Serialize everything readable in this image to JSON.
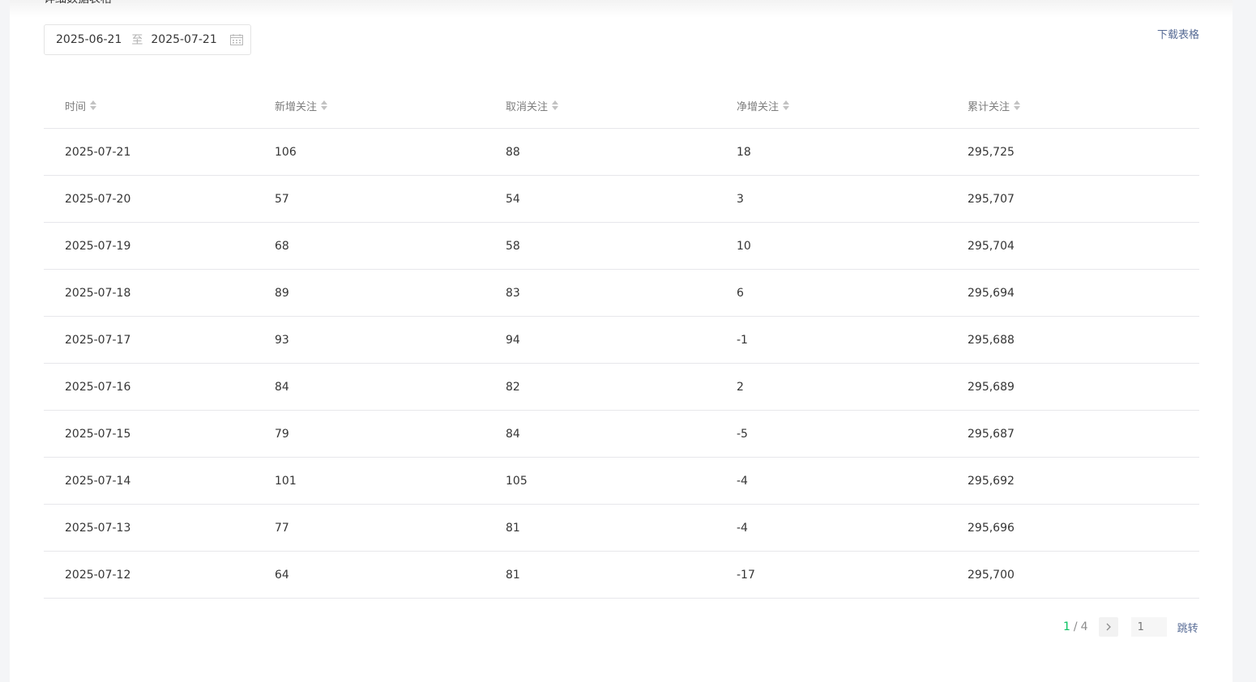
{
  "section": {
    "title": "详细数据表格"
  },
  "date_range": {
    "start": "2025-06-21",
    "separator": "至",
    "end": "2025-07-21"
  },
  "toolbar": {
    "download_label": "下载表格"
  },
  "table": {
    "columns": [
      "时间",
      "新增关注",
      "取消关注",
      "净增关注",
      "累计关注"
    ],
    "rows": [
      [
        "2025-07-21",
        "106",
        "88",
        "18",
        "295,725"
      ],
      [
        "2025-07-20",
        "57",
        "54",
        "3",
        "295,707"
      ],
      [
        "2025-07-19",
        "68",
        "58",
        "10",
        "295,704"
      ],
      [
        "2025-07-18",
        "89",
        "83",
        "6",
        "295,694"
      ],
      [
        "2025-07-17",
        "93",
        "94",
        "-1",
        "295,688"
      ],
      [
        "2025-07-16",
        "84",
        "82",
        "2",
        "295,689"
      ],
      [
        "2025-07-15",
        "79",
        "84",
        "-5",
        "295,687"
      ],
      [
        "2025-07-14",
        "101",
        "105",
        "-4",
        "295,692"
      ],
      [
        "2025-07-13",
        "77",
        "81",
        "-4",
        "295,696"
      ],
      [
        "2025-07-12",
        "64",
        "81",
        "-17",
        "295,700"
      ]
    ]
  },
  "pagination": {
    "current": "1",
    "separator": "/",
    "total": "4",
    "jump_placeholder": "1",
    "jump_label": "跳转"
  },
  "colors": {
    "accent": "#07c160",
    "link": "#576b95",
    "border": "#e7e7eb"
  },
  "icons": {
    "date_picker": "calendar-icon",
    "sort": "sort-icon",
    "next": "chevron-right-icon"
  }
}
